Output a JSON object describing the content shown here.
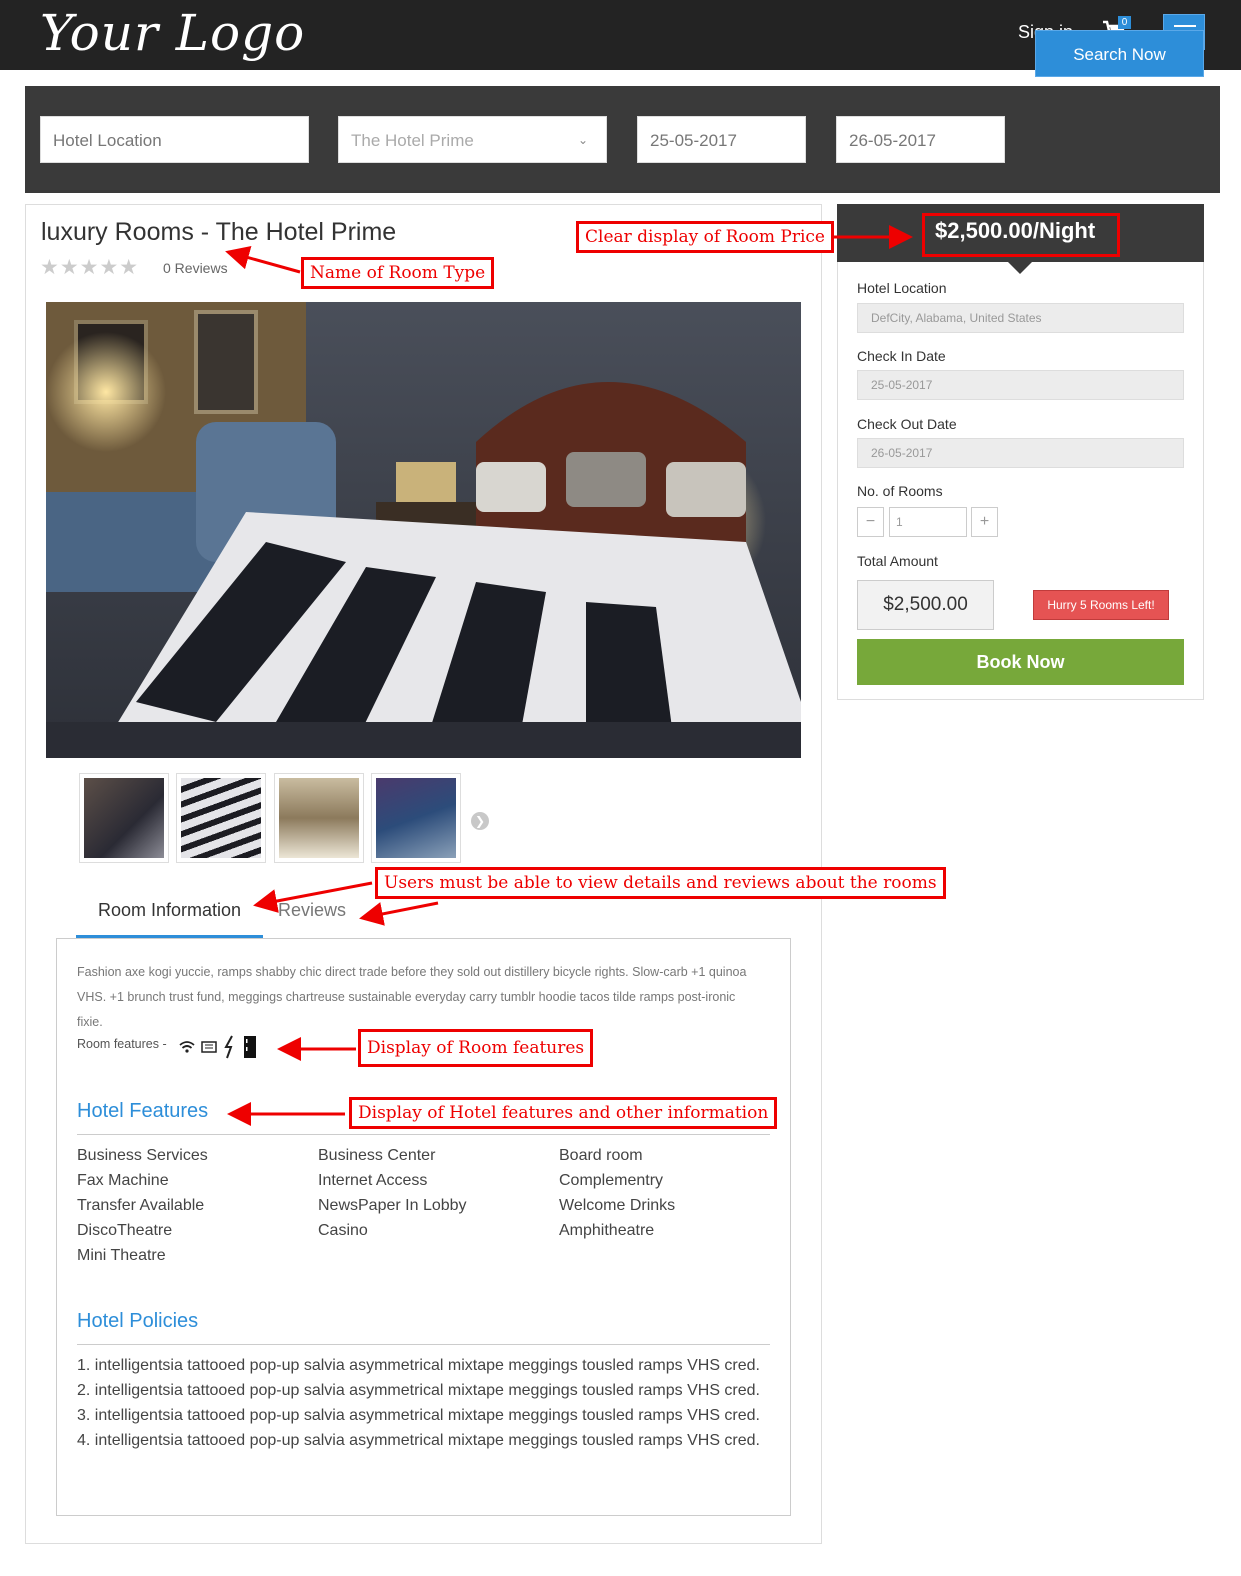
{
  "header": {
    "logo": "Your Logo",
    "signin": "Sign in",
    "cart_count": "0",
    "icons": [
      "cart-icon",
      "menu-icon"
    ]
  },
  "search": {
    "location_placeholder": "Hotel Location",
    "hotel_value": "The Hotel Prime",
    "checkin": "25-05-2017",
    "checkout": "26-05-2017",
    "button": "Search Now"
  },
  "room": {
    "title": "luxury Rooms - The Hotel Prime",
    "stars": "★★★★★",
    "rating": 0,
    "reviews": "0  Reviews",
    "thumbnails": [
      "thumb-1",
      "thumb-2",
      "thumb-3",
      "thumb-4"
    ]
  },
  "tabs": {
    "room_info": "Room Information",
    "reviews": "Reviews"
  },
  "room_info": {
    "description": "Fashion axe kogi yuccie, ramps shabby chic direct trade before they sold out distillery bicycle rights. Slow-carb +1 quinoa VHS. +1 brunch trust fund, meggings chartreuse sustainable everyday carry tumblr hoodie tacos tilde ramps post-ironic fixie.",
    "features_label": "Room features -",
    "feature_icons": [
      "wifi-icon",
      "newspaper-icon",
      "power-icon",
      "fridge-icon"
    ]
  },
  "hotel_features": {
    "title": "Hotel Features",
    "col1": [
      "Business Services",
      "Fax Machine",
      "Transfer Available",
      "DiscoTheatre",
      "Mini Theatre"
    ],
    "col2": [
      "Business Center",
      "Internet Access",
      "NewsPaper In Lobby",
      "Casino"
    ],
    "col3": [
      "Board room",
      "Complementry",
      "Welcome Drinks",
      "Amphitheatre"
    ]
  },
  "hotel_policies": {
    "title": "Hotel Policies",
    "items": [
      "1. intelligentsia tattooed pop-up salvia asymmetrical mixtape meggings tousled ramps VHS cred.",
      "2. intelligentsia tattooed pop-up salvia asymmetrical mixtape meggings tousled ramps VHS cred.",
      "3. intelligentsia tattooed pop-up salvia asymmetrical mixtape meggings tousled ramps VHS cred.",
      "4. intelligentsia tattooed pop-up salvia asymmetrical mixtape meggings tousled ramps VHS cred."
    ]
  },
  "booking": {
    "price": "$2,500.00/Night",
    "location_label": "Hotel Location",
    "location_value": "DefCity, Alabama, United States",
    "checkin_label": "Check In Date",
    "checkin_value": "25-05-2017",
    "checkout_label": "Check Out Date",
    "checkout_value": "26-05-2017",
    "rooms_label": "No. of Rooms",
    "rooms_value": "1",
    "minus": "−",
    "plus": "+",
    "total_label": "Total Amount",
    "total_value": "$2,500.00",
    "hurry": "Hurry  5  Rooms Left!",
    "book_button": "Book Now"
  },
  "annotations": {
    "room_price": "Clear display of Room Price",
    "room_type": "Name of Room Type",
    "view_details": "Users must be able to view details and reviews about the rooms",
    "room_features": "Display of Room features",
    "hotel_features": "Display of Hotel features and other information"
  },
  "colors": {
    "accent": "#2d8ed9",
    "book": "#77a83a",
    "hurry": "#e55353",
    "annotation": "#e00000",
    "header": "#232323"
  }
}
